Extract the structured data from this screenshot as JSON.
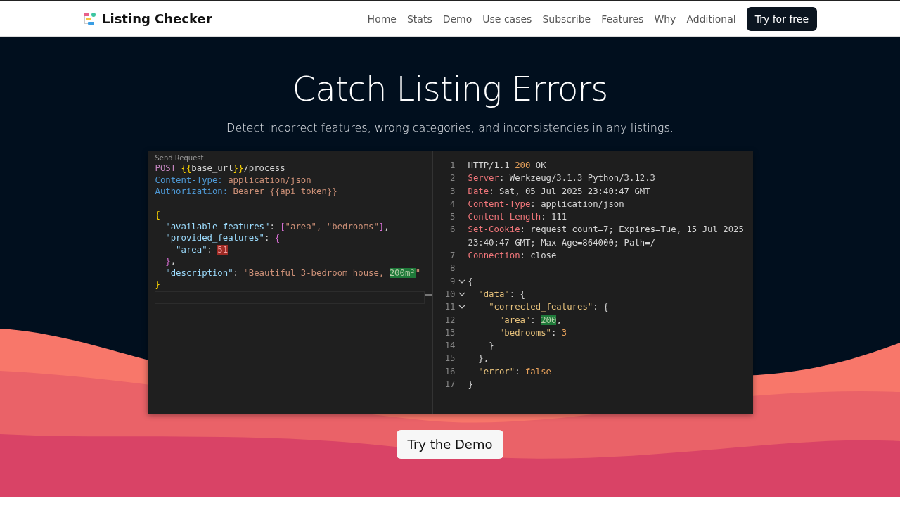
{
  "nav": {
    "brand": "Listing Checker",
    "links": [
      {
        "label": "Home"
      },
      {
        "label": "Stats"
      },
      {
        "label": "Demo"
      },
      {
        "label": "Use cases"
      },
      {
        "label": "Subscribe"
      },
      {
        "label": "Features"
      },
      {
        "label": "Why"
      },
      {
        "label": "Additional"
      }
    ],
    "cta": "Try for free"
  },
  "hero": {
    "title": "Catch Listing Errors",
    "subtitle": "Detect incorrect features, wrong categories, and inconsistencies in any listings.",
    "button": "Try the Demo"
  },
  "request": {
    "label": "Send Request",
    "lines": [
      {
        "tokens": [
          {
            "t": "POST ",
            "kind": "method"
          },
          {
            "t": "{{",
            "kind": "brace"
          },
          {
            "t": "base_url",
            "kind": "text"
          },
          {
            "t": "}}",
            "kind": "brace"
          },
          {
            "t": "/process",
            "kind": "text"
          }
        ]
      },
      {
        "tokens": [
          {
            "t": "Content-Type: ",
            "kind": "header"
          },
          {
            "t": "application/json",
            "kind": "string"
          }
        ]
      },
      {
        "tokens": [
          {
            "t": "Authorization: ",
            "kind": "header"
          },
          {
            "t": "Bearer {{api_token}}",
            "kind": "string"
          }
        ]
      }
    ],
    "body_lines": [
      {
        "tokens": [
          {
            "t": "{",
            "kind": "brace"
          }
        ]
      },
      {
        "tokens": [
          {
            "t": "  \"available_features\"",
            "kind": "key"
          },
          {
            "t": ": ",
            "kind": "text"
          },
          {
            "t": "[",
            "kind": "bracket"
          },
          {
            "t": "\"area\", \"bedrooms\"",
            "kind": "string"
          },
          {
            "t": "]",
            "kind": "bracket"
          },
          {
            "t": ",",
            "kind": "text"
          }
        ]
      },
      {
        "tokens": [
          {
            "t": "  \"provided_features\"",
            "kind": "key"
          },
          {
            "t": ": ",
            "kind": "text"
          },
          {
            "t": "{",
            "kind": "bracket"
          }
        ]
      },
      {
        "tokens": [
          {
            "t": "    \"area\"",
            "kind": "key"
          },
          {
            "t": ": ",
            "kind": "text"
          },
          {
            "t": "51",
            "kind": "bad"
          }
        ]
      },
      {
        "tokens": [
          {
            "t": "  }",
            "kind": "bracket"
          },
          {
            "t": ",",
            "kind": "text"
          }
        ]
      },
      {
        "tokens": [
          {
            "t": "  \"description\"",
            "kind": "key"
          },
          {
            "t": ": ",
            "kind": "text"
          },
          {
            "t": "\"Beautiful 3-bedroom house, ",
            "kind": "string"
          },
          {
            "t": "200m²",
            "kind": "good"
          },
          {
            "t": "\"",
            "kind": "string"
          }
        ]
      },
      {
        "tokens": [
          {
            "t": "}",
            "kind": "brace"
          }
        ]
      }
    ]
  },
  "response": {
    "lines": [
      {
        "number": "1",
        "fold": false,
        "tokens": [
          {
            "t": "HTTP/1.1 ",
            "kind": "text"
          },
          {
            "t": "200",
            "kind": "status"
          },
          {
            "t": " OK",
            "kind": "text"
          }
        ]
      },
      {
        "number": "2",
        "fold": false,
        "tokens": [
          {
            "t": "Server",
            "kind": "hname"
          },
          {
            "t": ": Werkzeug/3.1.3 Python/3.12.3",
            "kind": "text"
          }
        ]
      },
      {
        "number": "3",
        "fold": false,
        "tokens": [
          {
            "t": "Date",
            "kind": "hname"
          },
          {
            "t": ": Sat, 05 Jul 2025 23:40:47 GMT",
            "kind": "text"
          }
        ]
      },
      {
        "number": "4",
        "fold": false,
        "tokens": [
          {
            "t": "Content-Type",
            "kind": "hname"
          },
          {
            "t": ": application/json",
            "kind": "text"
          }
        ]
      },
      {
        "number": "5",
        "fold": false,
        "tokens": [
          {
            "t": "Content-Length",
            "kind": "hname"
          },
          {
            "t": ": 111",
            "kind": "text"
          }
        ]
      },
      {
        "number": "6",
        "fold": false,
        "tokens": [
          {
            "t": "Set-Cookie",
            "kind": "hname"
          },
          {
            "t": ": request_count=7; Expires=Tue, 15 Jul 2025 23:40:47 GMT; Max-Age=864000; Path=/",
            "kind": "text"
          }
        ]
      },
      {
        "number": "7",
        "fold": false,
        "tokens": [
          {
            "t": "Connection",
            "kind": "hname"
          },
          {
            "t": ": close",
            "kind": "text"
          }
        ]
      },
      {
        "number": "8",
        "fold": false
      },
      {
        "number": "9",
        "fold": true,
        "tokens": [
          {
            "t": "{",
            "kind": "text"
          }
        ]
      },
      {
        "number": "10",
        "fold": true,
        "tokens": [
          {
            "t": "  \"data\"",
            "kind": "rkey"
          },
          {
            "t": ": {",
            "kind": "text"
          }
        ]
      },
      {
        "number": "11",
        "fold": true,
        "tokens": [
          {
            "t": "    \"corrected_features\"",
            "kind": "rkey"
          },
          {
            "t": ": {",
            "kind": "text"
          }
        ]
      },
      {
        "number": "12",
        "fold": false,
        "tokens": [
          {
            "t": "      \"area\"",
            "kind": "rkey"
          },
          {
            "t": ": ",
            "kind": "text"
          },
          {
            "t": "200",
            "kind": "good"
          },
          {
            "t": ",",
            "kind": "text"
          }
        ]
      },
      {
        "number": "13",
        "fold": false,
        "tokens": [
          {
            "t": "      \"bedrooms\"",
            "kind": "rkey"
          },
          {
            "t": ": ",
            "kind": "text"
          },
          {
            "t": "3",
            "kind": "number"
          }
        ]
      },
      {
        "number": "14",
        "fold": false,
        "tokens": [
          {
            "t": "    }",
            "kind": "text"
          }
        ]
      },
      {
        "number": "15",
        "fold": false,
        "tokens": [
          {
            "t": "  },",
            "kind": "text"
          }
        ]
      },
      {
        "number": "16",
        "fold": false,
        "tokens": [
          {
            "t": "  \"error\"",
            "kind": "rkey"
          },
          {
            "t": ": ",
            "kind": "text"
          },
          {
            "t": "false",
            "kind": "number"
          }
        ]
      },
      {
        "number": "17",
        "fold": false,
        "tokens": [
          {
            "t": "}",
            "kind": "text"
          }
        ]
      }
    ]
  }
}
